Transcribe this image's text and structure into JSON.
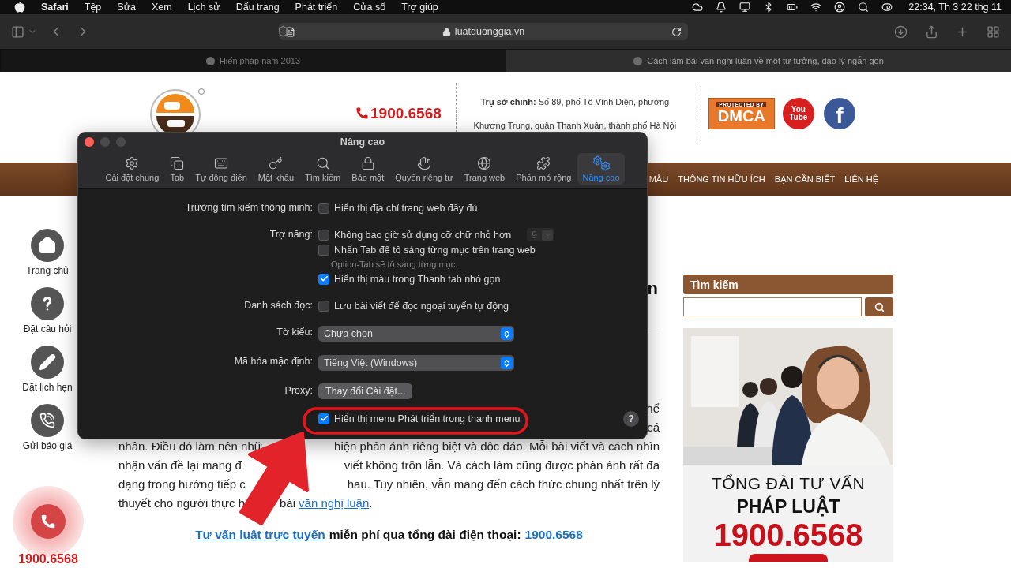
{
  "menu_bar": {
    "app": "Safari",
    "menus": [
      "Tệp",
      "Sửa",
      "Xem",
      "Lịch sử",
      "Dấu trang",
      "Phát triển",
      "Cửa sổ",
      "Trợ giúp"
    ],
    "clock": "22:34, Th 3 22 thg 11"
  },
  "browser": {
    "url": "luatduonggia.vn",
    "tabs": [
      {
        "title": "Hiến pháp năm 2013",
        "selected": false
      },
      {
        "title": "Cách làm bài văn nghị luận về một tư tưởng, đạo lý ngắn gọn",
        "selected": true
      }
    ]
  },
  "site": {
    "header": {
      "hotline": "1900.6568",
      "address": "**Trụ sở chính:** Số 89, phố Tô Vĩnh Diện, phường Khương Trung, quận Thanh Xuân, thành phố Hà Nội",
      "dmca": {
        "top": "PROTECTED BY",
        "main": "DMCA"
      },
      "youtube": [
        "You",
        "Tube"
      ],
      "facebook": "f"
    },
    "nav": [
      "MẪU",
      "THÔNG TIN HỮU ÍCH",
      "BẠN CẦN BIẾT",
      "LIÊN HỆ"
    ],
    "side_actions": [
      {
        "kind": "home",
        "label": "Trang chủ"
      },
      {
        "kind": "question",
        "label": "Đặt câu hỏi"
      },
      {
        "kind": "pencil",
        "label": "Đặt lịch hẹn"
      },
      {
        "kind": "phone",
        "label": "Gửi báo giá"
      }
    ],
    "article": {
      "heading_fragment": "n",
      "lines": [
        {
          "segments": [
            "hể"
          ]
        },
        {
          "segments": [
            "cá"
          ]
        },
        {
          "segments": [
            "nhân. Điều đó làm nên nhữ",
            "hiện phản ánh riêng biệt và độc đáo. Mỗi bài viết và cách nhìn"
          ]
        },
        {
          "segments": [
            "nhận vấn đề lại mang đ",
            "viết không trộn lẫn. Và cách làm cũng được phản ánh rất đa"
          ]
        },
        {
          "segments": [
            "dạng trong hướng tiếp c",
            "hau. Tuy nhiên, vẫn mang đến cách thức chung nhất trên lý"
          ]
        },
        {
          "segments": [
            "thuyết cho người thực h",
            "bài"
          ],
          "link": "văn nghị luận",
          "end": "."
        }
      ],
      "cta": {
        "link": "Tư vấn luật trực tuyến",
        "text": "miễn phí qua tổng đài điện thoại:",
        "phone": "1900.6568"
      }
    },
    "sidebar": {
      "search_title": "Tìm kiếm",
      "banner": {
        "line1": "TỔNG ĐÀI TƯ VẤN",
        "line2": "PHÁP LUẬT",
        "phone": "1900.6568"
      }
    },
    "floating_call": {
      "phone": "1900.6568"
    }
  },
  "dialog": {
    "title": "Nâng cao",
    "toolbar": [
      {
        "kind": "gear",
        "label": "Cài đặt chung",
        "selected": false
      },
      {
        "kind": "tabs",
        "label": "Tab",
        "selected": false
      },
      {
        "kind": "autofill",
        "label": "Tự động điền",
        "selected": false
      },
      {
        "kind": "key",
        "label": "Mật khẩu",
        "selected": false
      },
      {
        "kind": "search",
        "label": "Tìm kiếm",
        "selected": false
      },
      {
        "kind": "lock",
        "label": "Bảo mật",
        "selected": false
      },
      {
        "kind": "hand",
        "label": "Quyền riêng tư",
        "selected": false
      },
      {
        "kind": "globe",
        "label": "Trang web",
        "selected": false
      },
      {
        "kind": "puzzle",
        "label": "Phần mở rộng",
        "selected": false
      },
      {
        "kind": "gears",
        "label": "Nâng cao",
        "selected": true
      }
    ],
    "groups": [
      {
        "label": "Trường tìm kiếm thông minh:",
        "rows": [
          {
            "kind": "checkbox",
            "text": "Hiển thị địa chỉ trang web đầy đủ",
            "checked": false
          }
        ]
      },
      {
        "label": "Trợ năng:",
        "rows": [
          {
            "kind": "checkbox",
            "text": "Không bao giờ sử dụng cỡ chữ nhỏ hơn",
            "checked": false,
            "stepper": {
              "value": "9",
              "disabled": true
            }
          },
          {
            "kind": "checkbox",
            "text": "Nhấn Tab để tô sáng từng mục trên trang web",
            "checked": false
          },
          {
            "kind": "note",
            "text": "Option-Tab sẽ tô sáng từng mục."
          },
          {
            "kind": "checkbox",
            "text": "Hiển thị màu trong Thanh tab nhỏ gọn",
            "checked": true
          }
        ]
      },
      {
        "label": "Danh sách đọc:",
        "rows": [
          {
            "kind": "checkbox",
            "text": "Lưu bài viết để đọc ngoại tuyến tự động",
            "checked": false
          }
        ]
      },
      {
        "label": "Tờ kiểu:",
        "rows": [
          {
            "kind": "popup",
            "value": "Chưa chọn"
          }
        ]
      },
      {
        "label": "Mã hóa mặc định:",
        "rows": [
          {
            "kind": "popup",
            "value": "Tiếng Việt (Windows)"
          }
        ]
      },
      {
        "label": "Proxy:",
        "rows": [
          {
            "kind": "button",
            "text": "Thay đổi Cài đặt..."
          }
        ]
      },
      {
        "rows": [
          {
            "kind": "checkbox",
            "text": "Hiển thị menu Phát triển trong thanh menu",
            "checked": true
          }
        ]
      }
    ],
    "help": "?"
  }
}
